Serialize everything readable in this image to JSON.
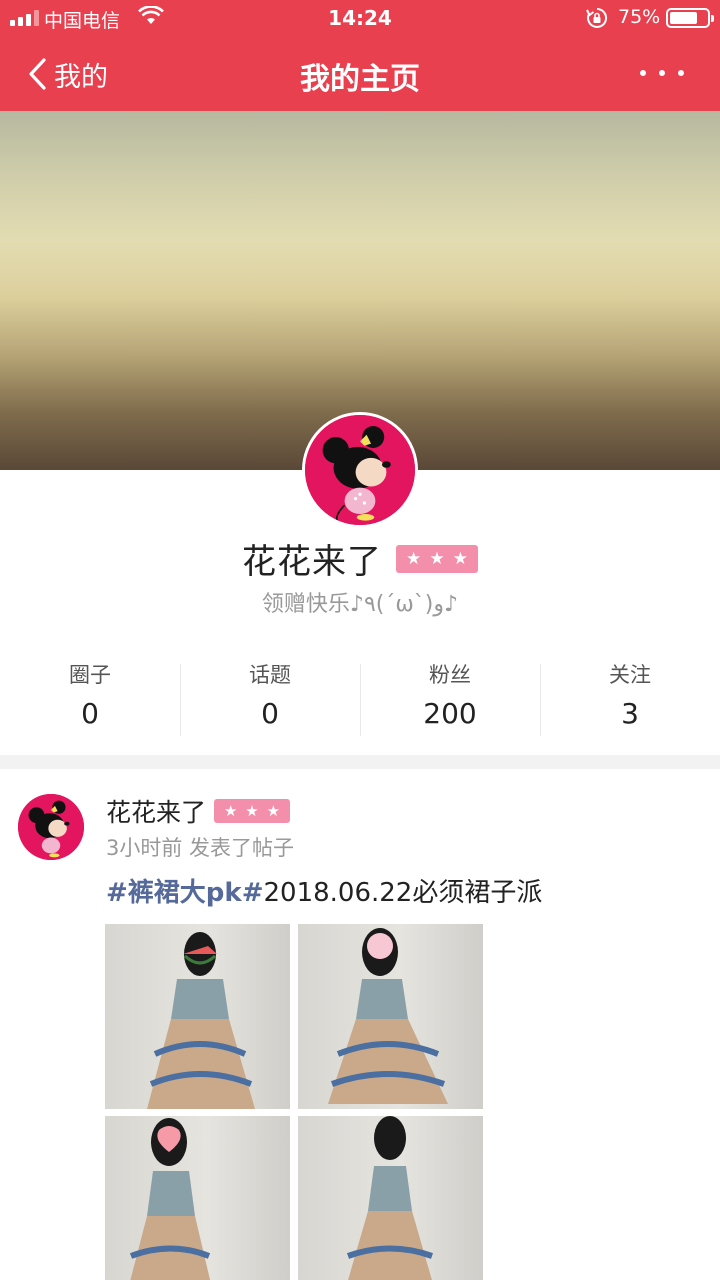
{
  "status_bar": {
    "carrier": "中国电信",
    "time": "14:24",
    "battery": "75%",
    "battery_level": 0.75
  },
  "nav": {
    "back_label": "我的",
    "title": "我的主页"
  },
  "profile": {
    "name": "花花来了",
    "level_stars": 3,
    "bio": "领赠快乐♪٩(´ω`)و♪"
  },
  "stats": [
    {
      "label": "圈子",
      "value": "0"
    },
    {
      "label": "话题",
      "value": "0"
    },
    {
      "label": "粉丝",
      "value": "200"
    },
    {
      "label": "关注",
      "value": "3"
    }
  ],
  "post": {
    "author": "花花来了",
    "meta": "3小时前 发表了帖子",
    "tag": "#裤裙大pk#",
    "text": "2018.06.22必须裙子派",
    "photo_count": 4
  },
  "colors": {
    "brand": "#e8404f",
    "badge": "#f48fab",
    "tag": "#55699a"
  }
}
